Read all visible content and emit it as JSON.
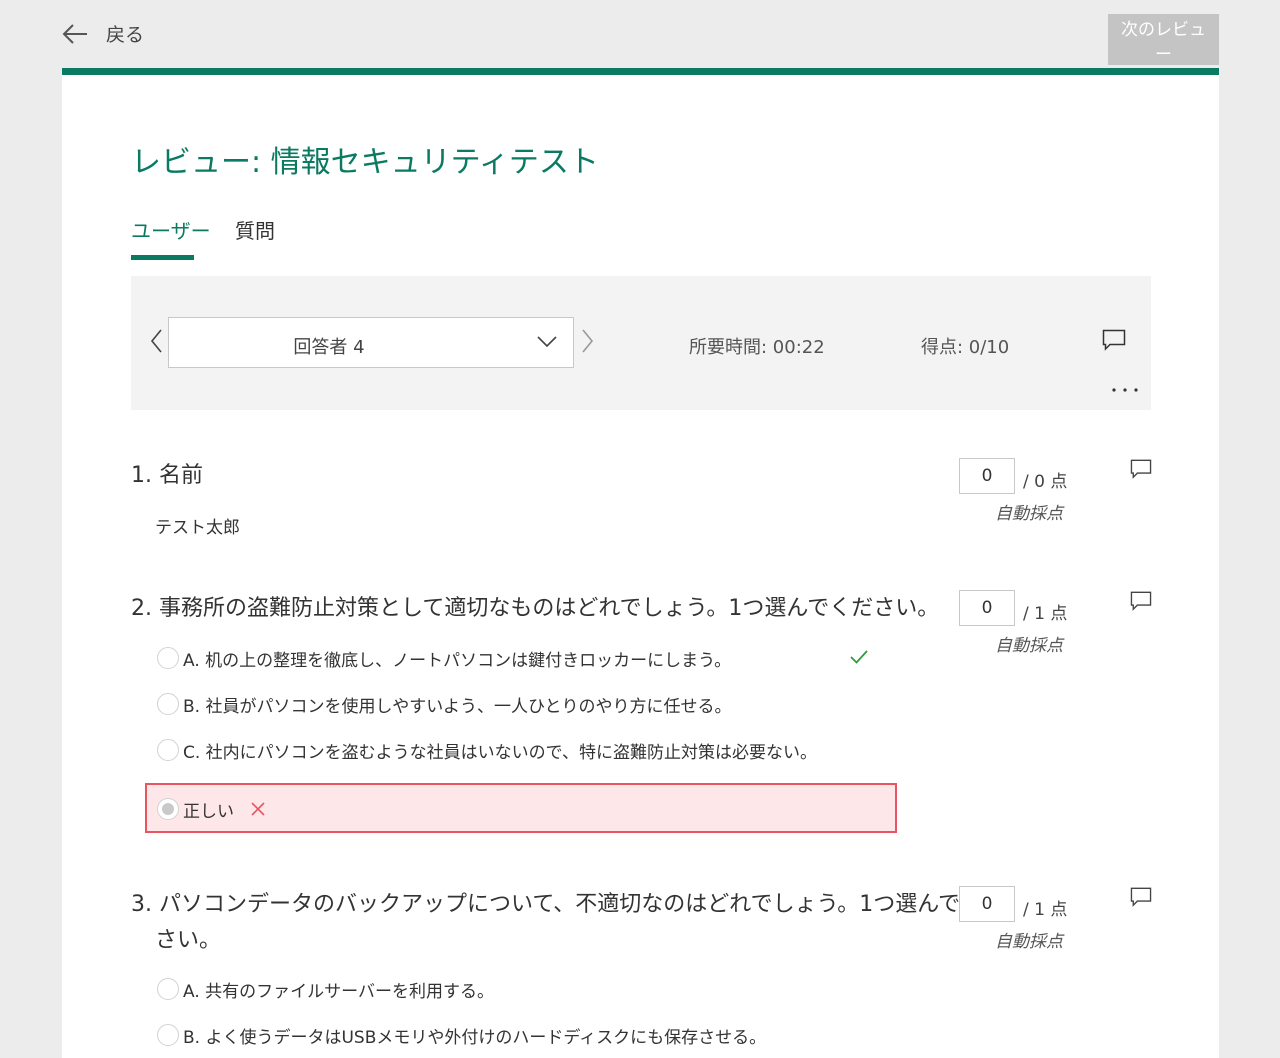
{
  "topbar": {
    "back_label": "戻る",
    "back_icon": "arrow-left-icon",
    "next_review_label": "次のレビュー"
  },
  "colors": {
    "accent": "#0b7a62",
    "error_bg": "#fde7e9",
    "error_border": "#e8545f",
    "check": "#2e9b3e",
    "cross": "#e8545f"
  },
  "page": {
    "title": "レビュー: 情報セキュリティテスト"
  },
  "tabs": [
    {
      "label": "ユーザー",
      "active": true
    },
    {
      "label": "質問",
      "active": false
    }
  ],
  "responder_panel": {
    "selected": "回答者 4",
    "time_label": "所要時間: 00:22",
    "score_label": "得点: 0/10"
  },
  "questions": [
    {
      "title": "1. 名前",
      "answer": "テスト太郎",
      "score": "0",
      "max": "/ 0 点",
      "grading": "自動採点"
    },
    {
      "title": "2. 事務所の盗難防止対策として適切なものはどれでしょう。1つ選んでください。",
      "score": "0",
      "max": "/ 1 点",
      "grading": "自動採点",
      "options": [
        {
          "label": "A. 机の上の整理を徹底し、ノートパソコンは鍵付きロッカーにしまう。",
          "correct": true
        },
        {
          "label": "B. 社員がパソコンを使用しやすいよう、一人ひとりのやり方に任せる。"
        },
        {
          "label": "C. 社内にパソコンを盗むような社員はいないので、特に盗難防止対策は必要ない。"
        }
      ],
      "selected_answer": {
        "label": "正しい",
        "result": "incorrect"
      }
    },
    {
      "title_line1": "3. パソコンデータのバックアップについて、不適切なのはどれでしょう。1つ選んでくだ",
      "title_line2": "さい。",
      "score": "0",
      "max": "/ 1 点",
      "grading": "自動採点",
      "options": [
        {
          "label": "A. 共有のファイルサーバーを利用する。"
        },
        {
          "label": "B. よく使うデータはUSBメモリや外付けのハードディスクにも保存させる。"
        }
      ]
    }
  ]
}
